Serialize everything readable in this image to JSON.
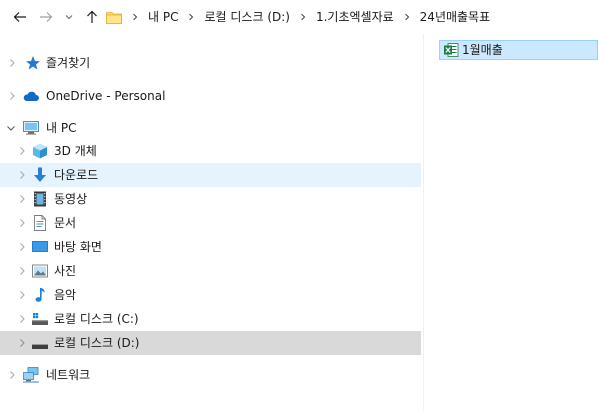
{
  "address_bar": {
    "path": [
      "내 PC",
      "로컬 디스크 (D:)",
      "1.기초엑셀자료",
      "24년매출목표"
    ]
  },
  "nav_pane": {
    "quick_access": "즐겨찾기",
    "onedrive": "OneDrive - Personal",
    "this_pc": "내 PC",
    "objects_3d": "3D 개체",
    "downloads": "다운로드",
    "videos": "동영상",
    "documents": "문서",
    "desktop": "바탕 화면",
    "pictures": "사진",
    "music": "음악",
    "drive_c": "로컬 디스크 (C:)",
    "drive_d": "로컬 디스크 (D:)",
    "network": "네트워크"
  },
  "files": [
    {
      "name": "1월매출",
      "icon": "excel-file-icon"
    }
  ],
  "colors": {
    "selection": "#cce8ff",
    "selection_border": "#99d1ff",
    "hover": "#e5f3ff",
    "nav_selected": "#d9d9d9"
  }
}
